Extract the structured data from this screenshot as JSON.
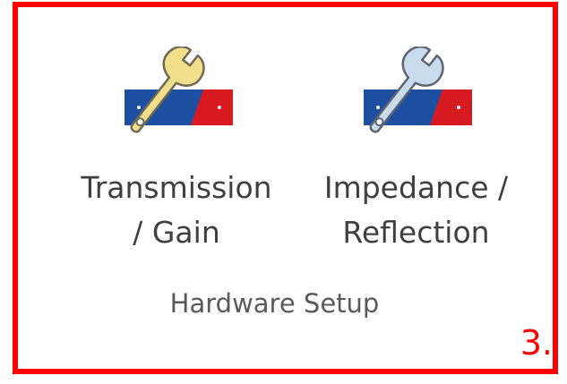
{
  "ribbon": {
    "buttons": [
      {
        "label_line1": "Transmission",
        "label_line2": "/ Gain",
        "icon": "wrench-transmission-icon",
        "wrench_color": "#f3df8a"
      },
      {
        "label_line1": "Impedance /",
        "label_line2": "Reflection",
        "icon": "wrench-impedance-icon",
        "wrench_color": "#c9dcee"
      }
    ],
    "group_label": "Hardware Setup"
  },
  "annotation": {
    "marker": "3.",
    "frame_color": "#ff0000"
  },
  "colors": {
    "strip_blue": "#1d4fa0",
    "strip_red": "#d71920",
    "text": "#3f3f3f"
  }
}
